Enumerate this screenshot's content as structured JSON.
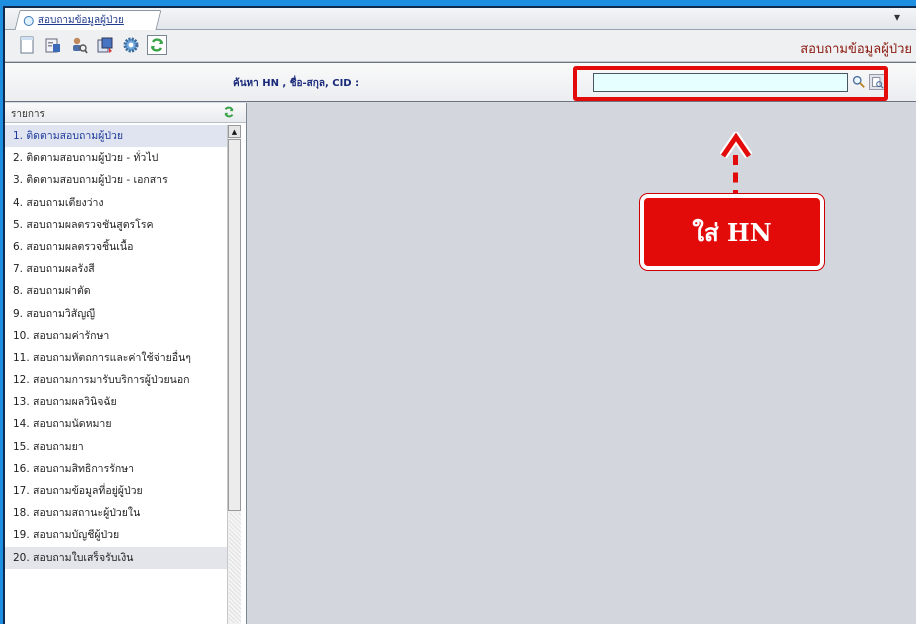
{
  "tab": {
    "label": "สอบถามข้อมูลผู้ป่วย",
    "menu_glyph": "▾"
  },
  "toolbar": {
    "icons": [
      "new-document-icon",
      "report-icon",
      "user-search-icon",
      "export-icon",
      "settings-gear-icon",
      "refresh-icon"
    ],
    "app_title": "สอบถามข้อมูลผู้ป่วย"
  },
  "search": {
    "label": "ค้นหา HN , ชื่อ-สกุล, CID :",
    "value": "",
    "placeholder": ""
  },
  "sidebar": {
    "title": "รายการ",
    "items": [
      "1. ติดตามสอบถามผู้ป่วย",
      "2. ติดตามสอบถามผู้ป่วย - ทั่วไป",
      "3. ติดตามสอบถามผู้ป่วย - เอกสาร",
      "4. สอบถามเตียงว่าง",
      "5. สอบถามผลตรวจชันสูตรโรค",
      "6. สอบถามผลตรวจชิ้นเนื้อ",
      "7. สอบถามผลรังสี",
      "8. สอบถามผ่าตัด",
      "9. สอบถามวิสัญญี",
      "10. สอบถามค่ารักษา",
      "11. สอบถามหัตถการและค่าใช้จ่ายอื่นๆ",
      "12. สอบถามการมารับบริการผู้ป่วยนอก",
      "13. สอบถามผลวินิจฉัย",
      "14. สอบถามนัดหมาย",
      "15. สอบถามยา",
      "16. สอบถามสิทธิการรักษา",
      "17. สอบถามข้อมูลที่อยู่ผู้ป่วย",
      "18. สอบถามสถานะผู้ป่วยใน",
      "19. สอบถามบัญชีผู้ป่วย",
      "20. สอบถามใบเสร็จรับเงิน"
    ]
  },
  "callout": {
    "text": "ใส่ HN"
  },
  "colors": {
    "accent_red": "#e30a0a",
    "title_red": "#8b1a10",
    "background_blue": "#1e8ee0"
  }
}
